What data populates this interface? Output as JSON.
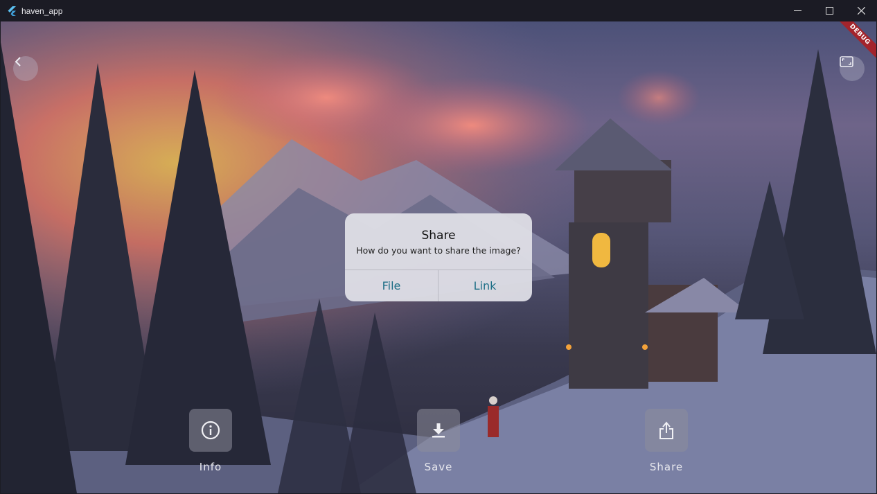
{
  "window": {
    "title": "haven_app",
    "controls": {
      "minimize": "minimize-icon",
      "maximize": "maximize-icon",
      "close": "close-icon"
    }
  },
  "debug_banner": "DEBUG",
  "nav": {
    "back_icon": "chevron-left-icon",
    "fullscreen_icon": "fullscreen-icon"
  },
  "dialog": {
    "title": "Share",
    "message": "How do you want to share the image?",
    "actions": [
      {
        "label": "File"
      },
      {
        "label": "Link"
      }
    ],
    "accent": "#1d6e86"
  },
  "actions": [
    {
      "label": "Info",
      "icon": "info-icon"
    },
    {
      "label": "Save",
      "icon": "download-icon"
    },
    {
      "label": "Share",
      "icon": "share-icon"
    }
  ]
}
